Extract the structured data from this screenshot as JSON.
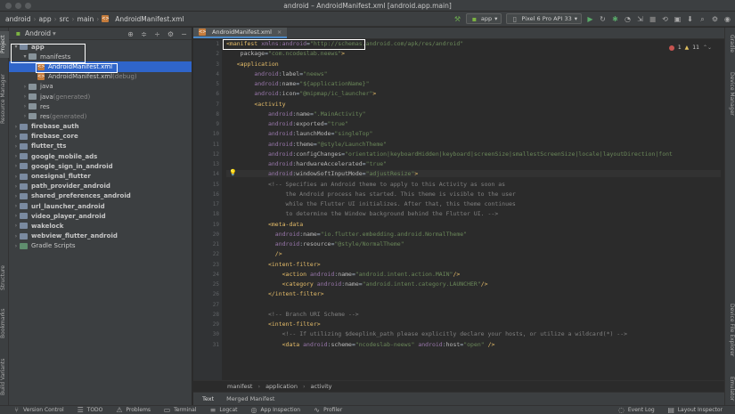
{
  "window": {
    "title": "android – AndroidManifest.xml [android.app.main]"
  },
  "breadcrumbs": [
    "android",
    "app",
    "src",
    "main"
  ],
  "breadcrumb_file": "AndroidManifest.xml",
  "toolbar": {
    "config": "app",
    "device": "Pixel 6 Pro API 33"
  },
  "project": {
    "view": "Android",
    "tree": [
      {
        "label": "app",
        "depth": 0,
        "arrow": "▾",
        "kind": "module"
      },
      {
        "label": "manifests",
        "depth": 1,
        "arrow": "▾",
        "kind": "folder"
      },
      {
        "label": "AndroidManifest.xml",
        "depth": 2,
        "arrow": "",
        "kind": "xml",
        "selected": true
      },
      {
        "label": "AndroidManifest.xml",
        "suffix": " (debug)",
        "depth": 2,
        "arrow": "",
        "kind": "xml"
      },
      {
        "label": "java",
        "depth": 1,
        "arrow": "›",
        "kind": "folder"
      },
      {
        "label": "java",
        "suffix": " (generated)",
        "depth": 1,
        "arrow": "›",
        "kind": "folder"
      },
      {
        "label": "res",
        "depth": 1,
        "arrow": "›",
        "kind": "folder"
      },
      {
        "label": "res",
        "suffix": " (generated)",
        "depth": 1,
        "arrow": "›",
        "kind": "folder"
      },
      {
        "label": "firebase_auth",
        "depth": 0,
        "arrow": "›",
        "kind": "module"
      },
      {
        "label": "firebase_core",
        "depth": 0,
        "arrow": "›",
        "kind": "module"
      },
      {
        "label": "flutter_tts",
        "depth": 0,
        "arrow": "›",
        "kind": "module"
      },
      {
        "label": "google_mobile_ads",
        "depth": 0,
        "arrow": "›",
        "kind": "module"
      },
      {
        "label": "google_sign_in_android",
        "depth": 0,
        "arrow": "›",
        "kind": "module"
      },
      {
        "label": "onesignal_flutter",
        "depth": 0,
        "arrow": "›",
        "kind": "module"
      },
      {
        "label": "path_provider_android",
        "depth": 0,
        "arrow": "›",
        "kind": "module"
      },
      {
        "label": "shared_preferences_android",
        "depth": 0,
        "arrow": "›",
        "kind": "module"
      },
      {
        "label": "url_launcher_android",
        "depth": 0,
        "arrow": "›",
        "kind": "module"
      },
      {
        "label": "video_player_android",
        "depth": 0,
        "arrow": "›",
        "kind": "module"
      },
      {
        "label": "wakelock",
        "depth": 0,
        "arrow": "›",
        "kind": "module"
      },
      {
        "label": "webview_flutter_android",
        "depth": 0,
        "arrow": "›",
        "kind": "module"
      },
      {
        "label": "Gradle Scripts",
        "depth": 0,
        "arrow": "›",
        "kind": "gradle"
      }
    ]
  },
  "left_tabs": [
    "Project",
    "Resource Manager",
    "Structure",
    "Bookmarks",
    "Build Variants"
  ],
  "right_tabs": [
    "Gradle",
    "Device Manager",
    "Device File Explorer",
    "Emulator"
  ],
  "editor": {
    "tab": "AndroidManifest.xml",
    "inspection": {
      "errors": "1",
      "warnings": "11"
    },
    "lines": [
      {
        "n": "1",
        "html": "<span class='tag'>&lt;manifest</span> <span class='ns'>xmlns:android</span>=<span class='val'>\"http://schemas.android.com/apk/res/android\"</span>"
      },
      {
        "n": "2",
        "html": "    <span class='attr'>package</span>=<span class='val'>\"com.ncodeslab.neews\"</span><span class='tag'>&gt;</span>"
      },
      {
        "n": "3",
        "html": "   <span class='tag'>&lt;application</span>"
      },
      {
        "n": "4",
        "html": "        <span class='ns'>android</span>:<span class='attr'>label</span>=<span class='val'>\"neews\"</span>"
      },
      {
        "n": "5",
        "html": "        <span class='ns'>android</span>:<span class='attr'>name</span>=<span class='val'>\"${applicationName}\"</span>"
      },
      {
        "n": "6",
        "html": "        <span class='ns'>android</span>:<span class='attr'>icon</span>=<span class='val'>\"@mipmap/ic_launcher\"</span><span class='tag'>&gt;</span>"
      },
      {
        "n": "7",
        "html": "        <span class='tag'>&lt;activity</span>"
      },
      {
        "n": "8",
        "html": "            <span class='ns'>android</span>:<span class='attr'>name</span>=<span class='val'>\".MainActivity\"</span>"
      },
      {
        "n": "9",
        "html": "            <span class='ns'>android</span>:<span class='attr'>exported</span>=<span class='val'>\"true\"</span>"
      },
      {
        "n": "10",
        "html": "            <span class='ns'>android</span>:<span class='attr'>launchMode</span>=<span class='val'>\"singleTop\"</span>"
      },
      {
        "n": "11",
        "html": "            <span class='ns'>android</span>:<span class='attr'>theme</span>=<span class='val'>\"@style/LaunchTheme\"</span>"
      },
      {
        "n": "12",
        "html": "            <span class='ns'>android</span>:<span class='attr'>configChanges</span>=<span class='val'>\"orientation|keyboardHidden|keyboard|screenSize|smallestScreenSize|locale|layoutDirection|font</span>"
      },
      {
        "n": "13",
        "html": "            <span class='ns'>android</span>:<span class='attr'>hardwareAccelerated</span>=<span class='val'>\"true\"</span>"
      },
      {
        "n": "14",
        "html": "            <span class='ns'>android</span>:<span class='attr'>windowSoftInputMode</span>=<span class='val'>\"adjustResize\"</span><span class='tag'>&gt;</span>",
        "hl": true
      },
      {
        "n": "15",
        "html": "            <span class='cmt'>&lt;!-- Specifies an Android theme to apply to this Activity as soon as</span>"
      },
      {
        "n": "16",
        "html": "<span class='cmt'>                 the Android process has started. This theme is visible to the user</span>"
      },
      {
        "n": "17",
        "html": "<span class='cmt'>                 while the Flutter UI initializes. After that, this theme continues</span>"
      },
      {
        "n": "18",
        "html": "<span class='cmt'>                 to determine the Window background behind the Flutter UI. --&gt;</span>"
      },
      {
        "n": "19",
        "html": "            <span class='tag'>&lt;meta-data</span>"
      },
      {
        "n": "20",
        "html": "              <span class='ns'>android</span>:<span class='attr'>name</span>=<span class='val'>\"io.flutter.embedding.android.NormalTheme\"</span>"
      },
      {
        "n": "21",
        "html": "              <span class='ns'>android</span>:<span class='attr'>resource</span>=<span class='val'>\"@style/NormalTheme\"</span>"
      },
      {
        "n": "22",
        "html": "              <span class='tag'>/&gt;</span>"
      },
      {
        "n": "23",
        "html": "            <span class='tag'>&lt;intent-filter&gt;</span>"
      },
      {
        "n": "24",
        "html": "                <span class='tag'>&lt;action</span> <span class='ns'>android</span>:<span class='attr'>name</span>=<span class='val'>\"android.intent.action.MAIN\"</span><span class='tag'>/&gt;</span>"
      },
      {
        "n": "25",
        "html": "                <span class='tag'>&lt;category</span> <span class='ns'>android</span>:<span class='attr'>name</span>=<span class='val'>\"android.intent.category.LAUNCHER\"</span><span class='tag'>/&gt;</span>"
      },
      {
        "n": "26",
        "html": "            <span class='tag'>&lt;/intent-filter&gt;</span>"
      },
      {
        "n": "27",
        "html": ""
      },
      {
        "n": "28",
        "html": "            <span class='cmt'>&lt;!-- Branch URI Scheme --&gt;</span>"
      },
      {
        "n": "29",
        "html": "            <span class='tag'>&lt;intent-filter&gt;</span>"
      },
      {
        "n": "30",
        "html": "                <span class='cmt'>&lt;!-- If utilizing $deeplink_path please explicitly declare your hosts, or utilize a wildcard(*) --&gt;</span>"
      },
      {
        "n": "31",
        "html": "                <span class='tag'>&lt;data</span> <span class='ns'>android</span>:<span class='attr'>scheme</span>=<span class='val'>\"ncodeslab-neews\"</span> <span class='ns'>android</span>:<span class='attr'>host</span>=<span class='val'>\"open\"</span> <span class='tag'>/&gt;</span>"
      }
    ],
    "breadcrumbs": [
      "manifest",
      "application",
      "activity"
    ],
    "bottom_tabs": [
      "Text",
      "Merged Manifest"
    ]
  },
  "status_bar": {
    "left": [
      "Version Control",
      "TODO",
      "Problems",
      "Terminal",
      "Logcat",
      "App Inspection",
      "Profiler"
    ],
    "right": [
      "Event Log",
      "Layout Inspector"
    ]
  }
}
